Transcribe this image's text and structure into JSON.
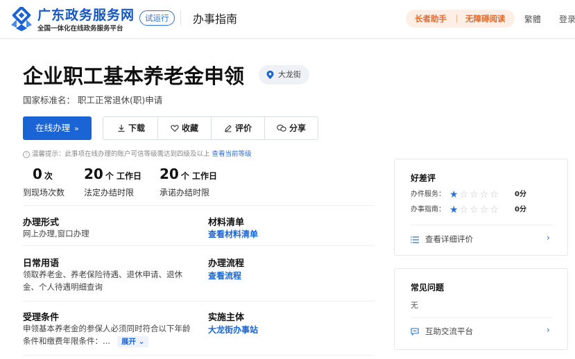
{
  "header": {
    "brand_name": "广东政务服务网",
    "brand_sub": "全国一体化在线政务服务平台",
    "trial_badge": "试运行",
    "guide_title": "办事指南",
    "elder_mode": "长者助手",
    "accessible_mode": "无障碍阅读",
    "traditional": "繁體",
    "login": "登录"
  },
  "item": {
    "title": "企业职工基本养老金申领",
    "location": "大龙街",
    "standard_name": "国家标准名：  职工正常退休(职)申请",
    "apply_button": "在线办理",
    "apply_arrow": "»",
    "actions": {
      "download": "下载",
      "favorite": "收藏",
      "review": "评价",
      "share": "分享"
    },
    "tip_text": "温馨提示：此事项在线办理的账户可信等级需达到四级及以上",
    "tip_link": "查看当前等级"
  },
  "stats": [
    {
      "value": "0",
      "unit": "次",
      "label": "到现场次数"
    },
    {
      "value": "20",
      "unit": "个 工作日",
      "label": "法定办结时限"
    },
    {
      "value": "20",
      "unit": "个 工作日",
      "label": "承诺办结时限"
    }
  ],
  "info": {
    "mode_title": "办理形式",
    "mode_value": "网上办理,窗口办理",
    "materials_title": "材料清单",
    "materials_link": "查看材料清单",
    "terms_title": "日常用语",
    "terms_value": "领取养老金、养老保险待遇、退休申请、退休金、个人待遇明细查询",
    "process_title": "办理流程",
    "process_link": "查看流程",
    "conditions_title": "受理条件",
    "conditions_value": "申领基本养老金的参保人必须同时符合以下年龄条件和缴费年限条件：...",
    "expand": "展开",
    "agency_title": "实施主体",
    "agency_link": "大龙街办事站"
  },
  "reviews": {
    "title": "好差评",
    "rows": [
      {
        "label": "办件服务：",
        "stars": 1,
        "score": "0分"
      },
      {
        "label": "办事指南：",
        "stars": 1,
        "score": "0分"
      }
    ],
    "detail_link": "查看详细评价"
  },
  "faq": {
    "title": "常见问题",
    "value": "无",
    "platform_link": "互助交流平台"
  },
  "colors": {
    "brand_blue": "#1a64d6",
    "accent_orange": "#e36a2a"
  }
}
